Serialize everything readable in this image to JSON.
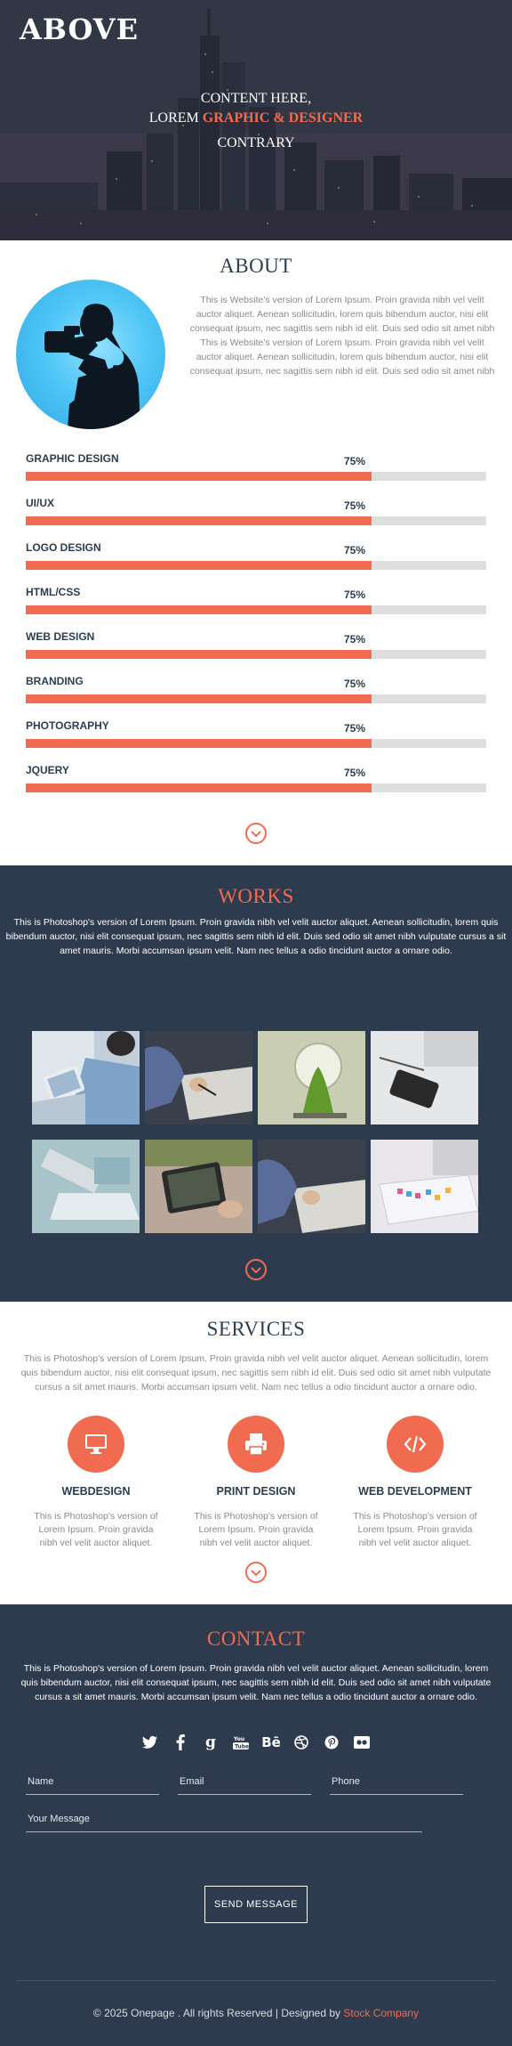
{
  "hero": {
    "logo": "ABOVE",
    "line1": "CONTENT HERE,",
    "line2_prefix": "LOREM",
    "line2_accent": "GRAPHIC & DESIGNER",
    "line3": "CONTRARY"
  },
  "about": {
    "title": "ABOUT",
    "text": "This is Website's version of Lorem Ipsum. Proin gravida nibh vel velit auctor aliquet. Aenean sollicitudin, lorem quis bibendum auctor, nisi elit consequat ipsum, nec sagittis sem nibh id elit. Duis sed odio sit amet nibh This is Website's version of Lorem Ipsum. Proin gravida nibh vel velit auctor aliquet. Aenean sollicitudin, lorem quis bibendum auctor, nisi elit consequat ipsum, nec sagittis sem nibh id elit. Duis sed odio sit amet nibh",
    "skills": [
      {
        "name": "GRAPHIC DESIGN",
        "percent_label": "75%",
        "value": 0.75
      },
      {
        "name": "UI/UX",
        "percent_label": "75%",
        "value": 0.75
      },
      {
        "name": "LOGO DESIGN",
        "percent_label": "75%",
        "value": 0.75
      },
      {
        "name": "HTML/CSS",
        "percent_label": "75%",
        "value": 0.75
      },
      {
        "name": "WEB DESIGN",
        "percent_label": "75%",
        "value": 0.75
      },
      {
        "name": "BRANDING",
        "percent_label": "75%",
        "value": 0.75
      },
      {
        "name": "PHOTOGRAPHY",
        "percent_label": "75%",
        "value": 0.75
      },
      {
        "name": "JQUERY",
        "percent_label": "75%",
        "value": 0.75
      }
    ]
  },
  "works": {
    "title": "WORKS",
    "text": "This is Photoshop's version of Lorem Ipsum. Proin gravida nibh vel velit auctor aliquet. Aenean sollicitudin, lorem quis bibendum auctor, nisi elit consequat ipsum, nec sagittis sem nibh id elit. Duis sed odio sit amet nibh vulputate cursus a sit amet mauris. Morbi accumsan ipsum velit. Nam nec tellus a odio tincidunt auctor a ornare odio.",
    "thumbnails": [
      "tablet-on-lap",
      "writing-notebook",
      "lightbulb-plant",
      "desk-phone",
      "laptop-desk",
      "tablet-reading",
      "writing-notebook-2",
      "imac-keyboard"
    ]
  },
  "services": {
    "title": "SERVICES",
    "text": "This is Photoshop's version of Lorem Ipsum. Proin gravida nibh vel velit auctor aliquet. Aenean sollicitudin, lorem quis bibendum auctor, nisi elit consequat ipsum, nec sagittis sem nibh id elit. Duis sed odio sit amet nibh vulputate cursus a sit amet mauris. Morbi accumsan ipsum velit. Nam nec tellus a odio tincidunt auctor a ornare odio.",
    "items": [
      {
        "icon": "monitor-icon",
        "title": "WEBDESIGN",
        "text": "This is Photoshop's version of Lorem Ipsum. Proin gravida nibh vel velit auctor aliquet."
      },
      {
        "icon": "printer-icon",
        "title": "PRINT DESIGN",
        "text": "This is Photoshop's version of Lorem Ipsum. Proin gravida nibh vel velit auctor aliquet."
      },
      {
        "icon": "code-icon",
        "title": "WEB DEVELOPMENT",
        "text": "This is Photoshop's version of Lorem Ipsum. Proin gravida nibh vel velit auctor aliquet."
      }
    ]
  },
  "contact": {
    "title": "CONTACT",
    "text": "This is Photoshop's version of Lorem Ipsum. Proin gravida nibh vel velit auctor aliquet. Aenean sollicitudin, lorem quis bibendum auctor, nisi elit consequat ipsum, nec sagittis sem nibh id elit. Duis sed odio sit amet nibh vulputate cursus a sit amet mauris. Morbi accumsan ipsum velit. Nam nec tellus a odio tincidunt auctor a ornare odio.",
    "socials": [
      "twitter-icon",
      "facebook-icon",
      "google-plus-icon",
      "youtube-icon",
      "behance-icon",
      "dribbble-icon",
      "pinterest-icon",
      "flickr-icon"
    ],
    "name_placeholder": "Name",
    "email_placeholder": "Email",
    "phone_placeholder": "Phone",
    "message_placeholder": "Your Message",
    "send_label": "SEND MESSAGE"
  },
  "footer": {
    "text": "© 2025 Onepage . All rights Reserved | Designed by",
    "brand": "Stock Company"
  },
  "colors": {
    "accent": "#f06b4f",
    "dark": "#2e3b4e",
    "track": "#dedede"
  }
}
